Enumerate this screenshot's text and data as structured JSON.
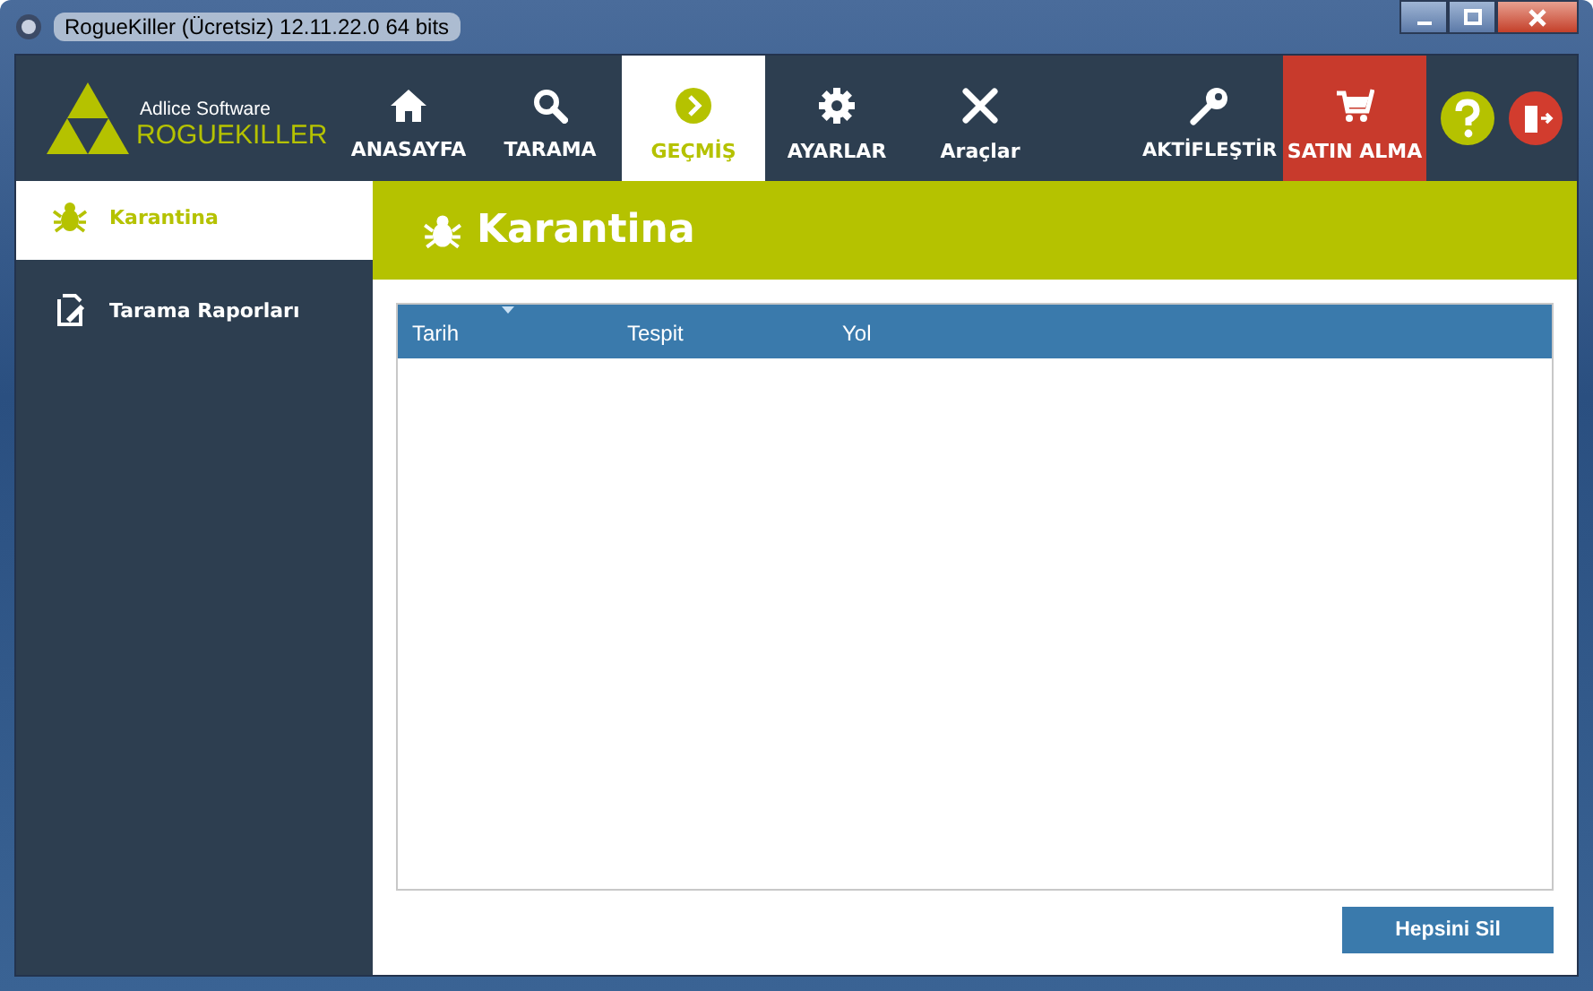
{
  "window": {
    "title": "RogueKiller (Ücretsiz) 12.11.22.0 64 bits"
  },
  "brand": {
    "company": "Adlice Software",
    "product": "ROGUEKILLER"
  },
  "nav": {
    "main": [
      {
        "label": "ANASAYFA",
        "selected": false
      },
      {
        "label": "TARAMA",
        "selected": false
      },
      {
        "label": "GEÇMİŞ",
        "selected": true
      },
      {
        "label": "AYARLAR",
        "selected": false
      },
      {
        "label": "Araçlar",
        "selected": false
      }
    ],
    "right": [
      {
        "label": "AKTİFLEŞTİR",
        "kind": "plain"
      },
      {
        "label": "SATIN ALMA",
        "kind": "buy"
      }
    ]
  },
  "sidebar": {
    "items": [
      {
        "label": "Karantina",
        "selected": true
      },
      {
        "label": "Tarama Raporları",
        "selected": false
      }
    ]
  },
  "page": {
    "title": "Karantina"
  },
  "table": {
    "columns": [
      {
        "label": "Tarih",
        "sorted": true
      },
      {
        "label": "Tespit",
        "sorted": false
      },
      {
        "label": "Yol",
        "sorted": false
      }
    ]
  },
  "buttons": [
    "Hepsini Sil"
  ]
}
